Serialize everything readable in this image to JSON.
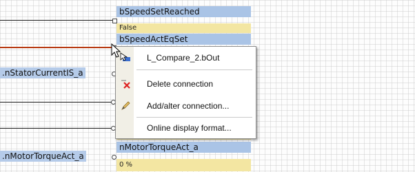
{
  "blocks": {
    "speed_set_reached": {
      "name": "bSpeedSetReached",
      "value": "False"
    },
    "speed_act_eq_set": {
      "name": "bSpeedActEqSet",
      "value": ""
    },
    "motor_torque_act": {
      "name": "nMotorTorqueAct_a",
      "value": "0 %",
      "partial_value_above": "0 %"
    }
  },
  "side_labels": {
    "stator_current": ".nStatorCurrentIS_a",
    "motor_torque": ".nMotorTorqueAct_a"
  },
  "context_menu": {
    "items": [
      {
        "label": "L_Compare_2.bOut",
        "icon": "connection-arrow-icon"
      },
      {
        "label": "Delete connection",
        "icon": "delete-x-icon"
      },
      {
        "label": "Add/alter connection...",
        "icon": "pencil-edit-icon"
      },
      {
        "label": "Online display format...",
        "icon": ""
      }
    ]
  },
  "colors": {
    "name_fill": "#aac4e6",
    "value_fill": "#f3e6a2",
    "active_wire": "#b83a12"
  }
}
